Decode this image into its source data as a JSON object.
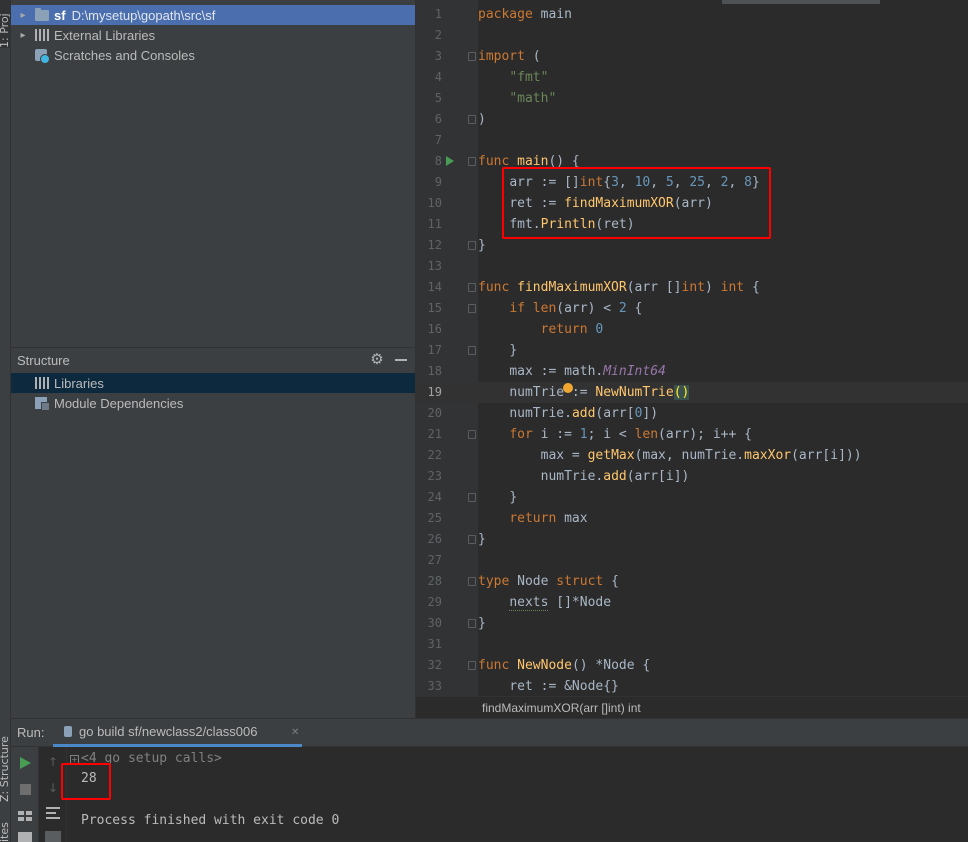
{
  "stripes": {
    "project": "1: Proj",
    "structure": "Z: Structure",
    "favorites": "ites"
  },
  "project_tree": {
    "root": {
      "name": "sf",
      "path": "D:\\mysetup\\gopath\\src\\sf"
    },
    "external_libraries": "External Libraries",
    "scratches": "Scratches and Consoles"
  },
  "structure": {
    "title": "Structure",
    "items": [
      {
        "label": "Libraries",
        "icon": "libraries-icon"
      },
      {
        "label": "Module Dependencies",
        "icon": "module-icon"
      }
    ]
  },
  "editor": {
    "current_line": 19,
    "lines": [
      "1",
      "2",
      "3",
      "4",
      "5",
      "6",
      "7",
      "8",
      "9",
      "10",
      "11",
      "12",
      "13",
      "14",
      "15",
      "16",
      "17",
      "18",
      "19",
      "20",
      "21",
      "22",
      "23",
      "24",
      "25",
      "26",
      "27",
      "28",
      "29",
      "30",
      "31",
      "32",
      "33"
    ],
    "code": {
      "l1_k": "package",
      "l1_t": " main",
      "l3_k": "import",
      "l3_t": " (",
      "l4": "\"fmt\"",
      "l5": "\"math\"",
      "l6": ")",
      "l8_k": "func",
      "l8_f": "main",
      "l8_t": "() {",
      "l9_a": "arr := []",
      "l9_k": "int",
      "l9_b": "{",
      "l9_n1": "3",
      "l9_c1": ", ",
      "l9_n2": "10",
      "l9_c2": ", ",
      "l9_n3": "5",
      "l9_c3": ", ",
      "l9_n4": "25",
      "l9_c4": ", ",
      "l9_n5": "2",
      "l9_c5": ", ",
      "l9_n6": "8",
      "l9_e": "}",
      "l10_a": "ret := ",
      "l10_f": "findMaximumXOR",
      "l10_b": "(arr)",
      "l11_a": "fmt.",
      "l11_f": "Println",
      "l11_b": "(ret)",
      "l12": "}",
      "l14_k": "func",
      "l14_f": "findMaximumXOR",
      "l14_a": "(arr []",
      "l14_k2": "int",
      "l14_b": ") ",
      "l14_k3": "int",
      "l14_c": " {",
      "l15_k": "if",
      "l15_f": "len",
      "l15_a": "(arr) < ",
      "l15_n": "2",
      "l15_b": " {",
      "l16_k": "return",
      "l16_n": "0",
      "l17": "}",
      "l18_a": "max := math.",
      "l18_p": "MinInt64",
      "l19_a": "numTrie := ",
      "l19_f": "NewNumTrie",
      "l19_b": "()",
      "l20_a": "numTrie.",
      "l20_f": "add",
      "l20_b": "(arr[",
      "l20_n": "0",
      "l20_c": "])",
      "l21_k": "for",
      "l21_a": " i := ",
      "l21_n": "1",
      "l21_b": "; i < ",
      "l21_f": "len",
      "l21_c": "(arr); i++ {",
      "l22_a": "max = ",
      "l22_f": "getMax",
      "l22_b": "(max, numTrie.",
      "l22_f2": "maxXor",
      "l22_c": "(arr[i]))",
      "l23_a": "numTrie.",
      "l23_f": "add",
      "l23_b": "(arr[i])",
      "l24": "}",
      "l25_k": "return",
      "l25_t": " max",
      "l26": "}",
      "l28_k": "type",
      "l28_t": " Node ",
      "l28_k2": "struct",
      "l28_b": " {",
      "l29_a": "nexts",
      "l29_b": " []*Node",
      "l30": "}",
      "l32_k": "func",
      "l32_f": "NewNode",
      "l32_b": "() *Node {",
      "l33_a": "ret := &Node{}"
    }
  },
  "breadcrumb": "findMaximumXOR(arr []int) int",
  "run": {
    "label": "Run:",
    "tab_title": "go build sf/newclass2/class006",
    "setup_calls": "<4 go setup calls>",
    "output": "28",
    "process": "Process finished with exit code 0"
  },
  "colors": {
    "keyword": "#cc7832",
    "string": "#6a8759",
    "number": "#6897bb",
    "function": "#ffc66d",
    "constant": "#9876aa",
    "highlight_box": "#ff0000",
    "selection": "#4b6eaf"
  }
}
